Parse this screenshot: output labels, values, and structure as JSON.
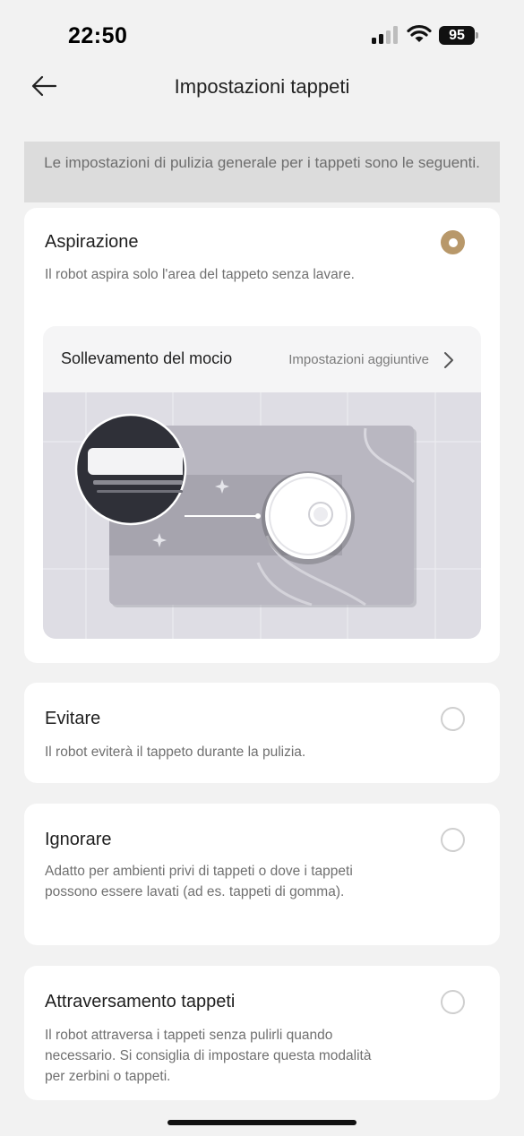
{
  "status_bar": {
    "time": "22:50",
    "battery": "95"
  },
  "nav": {
    "title": "Impostazioni tappeti"
  },
  "info_banner": {
    "text": "Le impostazioni di pulizia generale per i tappeti sono le seguenti."
  },
  "options": [
    {
      "title": "Aspirazione",
      "description": "Il robot aspira solo l'area del tappeto senza lavare.",
      "selected": true
    },
    {
      "title": "Evitare",
      "description": "Il robot eviterà il tappeto durante la pulizia.",
      "selected": false
    },
    {
      "title": "Ignorare",
      "description": "Adatto per ambienti privi di tappeti o dove i tappeti possono essere lavati (ad es. tappeti di gomma).",
      "selected": false
    },
    {
      "title": "Attraversamento tappeti",
      "description": "Il robot attraversa i tappeti senza pulirli quando necessario. Si consiglia di impostare questa modalità per zerbini o tappeti.",
      "selected": false
    }
  ],
  "mop_lift": {
    "label": "Sollevamento del mocio",
    "extra": "Impostazioni aggiuntive"
  },
  "colors": {
    "accent": "#b8986a",
    "background": "#f2f2f2",
    "card": "#ffffff",
    "banner": "#dcdcdc"
  },
  "icons": [
    "back-arrow-icon",
    "signal-icon",
    "wifi-icon",
    "battery-icon",
    "chevron-right-icon"
  ]
}
